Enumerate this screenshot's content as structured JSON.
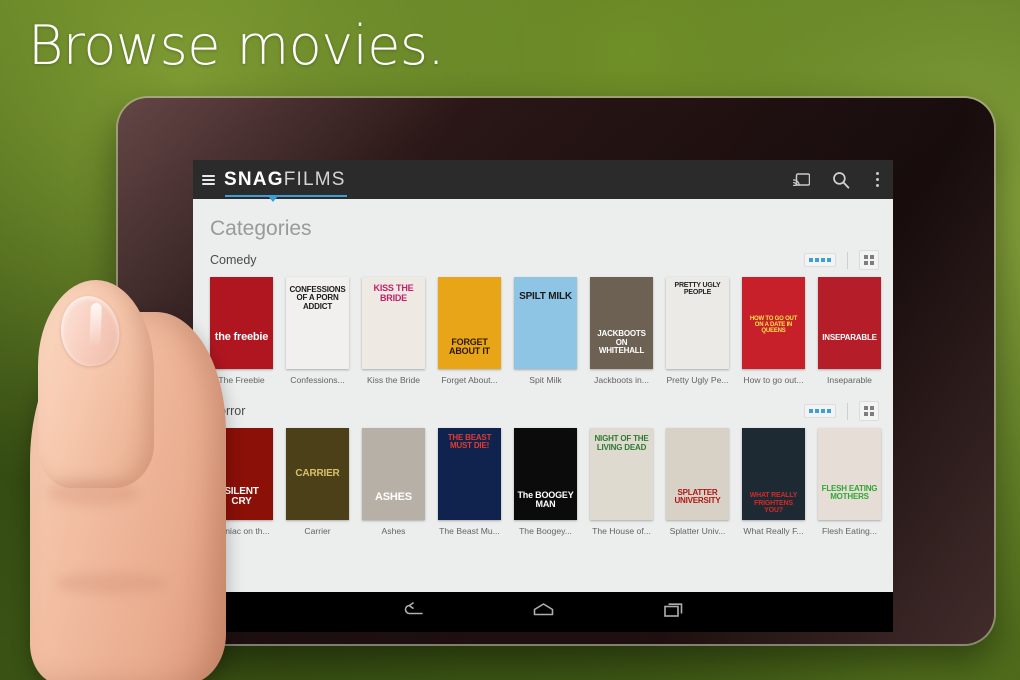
{
  "headline": "Browse movies.",
  "app": {
    "brand_primary": "SNAG",
    "brand_secondary": "FILMS",
    "accent_color": "#3c9fd6",
    "actionbar_bg": "#2b2b2b",
    "icons": {
      "menu": "hamburger-icon",
      "cast": "cast-icon",
      "search": "search-icon",
      "overflow": "overflow-menu-icon"
    }
  },
  "content": {
    "page_title": "Categories",
    "rows": [
      {
        "title": "Comedy",
        "view_toggle": "carousel-view",
        "grid_toggle": "grid-view",
        "items": [
          {
            "caption": "The Freebie",
            "poster_text": "the freebie",
            "bg": "#b01620",
            "fg": "#ffffff",
            "size": 11,
            "pos": 60
          },
          {
            "caption": "Confessions...",
            "poster_text": "CONFESSIONS OF A PORN ADDICT",
            "bg": "#f2f0ee",
            "fg": "#1b1b1b",
            "size": 8,
            "pos": 10
          },
          {
            "caption": "Kiss the Bride",
            "poster_text": "KISS THE BRIDE",
            "bg": "#efe9e4",
            "fg": "#c0216b",
            "size": 9,
            "pos": 8
          },
          {
            "caption": "Forget About...",
            "poster_text": "FORGET ABOUT IT",
            "bg": "#e8a518",
            "fg": "#2a1a06",
            "size": 9,
            "pos": 66
          },
          {
            "caption": "Spit Milk",
            "poster_text": "SPILT MILK",
            "bg": "#8ec4e4",
            "fg": "#1b1b1b",
            "size": 10,
            "pos": 16
          },
          {
            "caption": "Jackboots in...",
            "poster_text": "JACKBOOTS ON WHITEHALL",
            "bg": "#6d6154",
            "fg": "#ffffff",
            "size": 8,
            "pos": 58
          },
          {
            "caption": "Pretty Ugly Pe...",
            "poster_text": "PRETTY UGLY PEOPLE",
            "bg": "#eceae6",
            "fg": "#262626",
            "size": 7,
            "pos": 5
          },
          {
            "caption": "How to go out...",
            "poster_text": "HOW TO GO OUT ON A DATE IN QUEENS",
            "bg": "#c8202a",
            "fg": "#f7e24a",
            "size": 6,
            "pos": 42
          },
          {
            "caption": "Inseparable",
            "poster_text": "INSEPARABLE",
            "bg": "#b51d28",
            "fg": "#ffffff",
            "size": 8,
            "pos": 62
          }
        ]
      },
      {
        "title": "Horror",
        "view_toggle": "carousel-view",
        "grid_toggle": "grid-view",
        "items": [
          {
            "caption": "Maniac on th...",
            "poster_text": "SILENT CRY",
            "bg": "#8b1008",
            "fg": "#ffffff",
            "size": 10,
            "pos": 64
          },
          {
            "caption": "Carrier",
            "poster_text": "CARRIER",
            "bg": "#4b4018",
            "fg": "#d8c06a",
            "size": 10,
            "pos": 45
          },
          {
            "caption": "Ashes",
            "poster_text": "ASHES",
            "bg": "#b7b0a6",
            "fg": "#ffffff",
            "size": 11,
            "pos": 70
          },
          {
            "caption": "The Beast Mu...",
            "poster_text": "THE BEAST MUST DIE!",
            "bg": "#10234f",
            "fg": "#e23b2e",
            "size": 8,
            "pos": 6
          },
          {
            "caption": "The Boogey...",
            "poster_text": "The BOOGEY MAN",
            "bg": "#0b0b0b",
            "fg": "#ffffff",
            "size": 9,
            "pos": 68
          },
          {
            "caption": "The House of...",
            "poster_text": "NIGHT OF THE LIVING DEAD",
            "bg": "#dedacf",
            "fg": "#2f7a33",
            "size": 8,
            "pos": 8
          },
          {
            "caption": "Splatter Univ...",
            "poster_text": "SPLATTER UNIVERSITY",
            "bg": "#d8d2c6",
            "fg": "#b01515",
            "size": 8,
            "pos": 66
          },
          {
            "caption": "What Really F...",
            "poster_text": "WHAT REALLY FRIGHTENS YOU?",
            "bg": "#1d2a33",
            "fg": "#cf2a2a",
            "size": 7,
            "pos": 70
          },
          {
            "caption": "Flesh Eating...",
            "poster_text": "FLESH EATING MOTHERS",
            "bg": "#e6ddd6",
            "fg": "#2ea832",
            "size": 8,
            "pos": 62
          }
        ]
      }
    ]
  },
  "navbar": {
    "back": "back-icon",
    "home": "home-icon",
    "recents": "recents-icon"
  }
}
